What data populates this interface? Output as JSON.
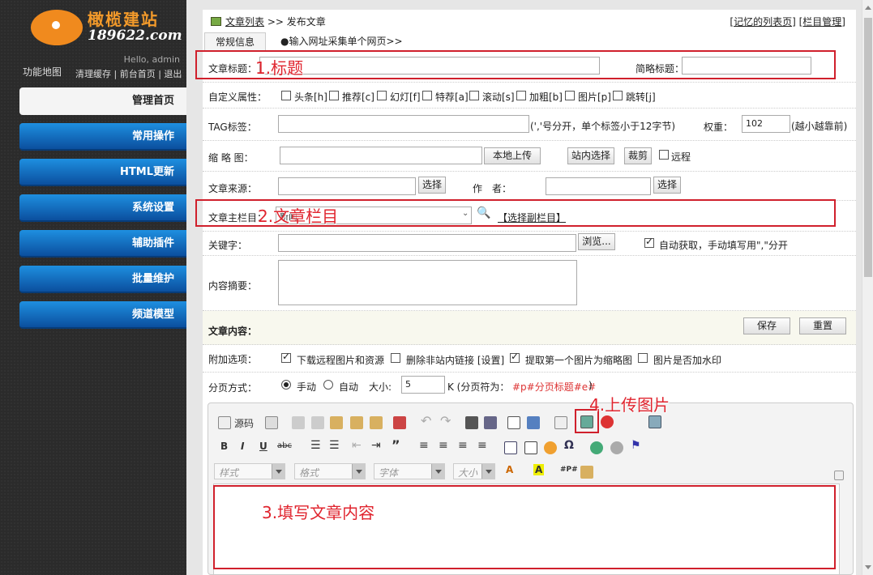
{
  "sidebar": {
    "logo_text": "橄榄建站",
    "logo_url": "189622.com",
    "hello": "Hello, admin",
    "map_link": "功能地图",
    "top_links": [
      "清理缓存",
      "前台首页",
      "退出"
    ],
    "nav_items": [
      "管理首页",
      "常用操作",
      "HTML更新",
      "系统设置",
      "辅助插件",
      "批量维护",
      "频道模型"
    ]
  },
  "header": {
    "crumb_link": "文章列表",
    "crumb_sep": ">>",
    "crumb_current": "发布文章",
    "right_links": [
      "[记忆的列表页]",
      "[栏目管理]"
    ],
    "tabs": [
      "常规信息",
      "●输入网址采集单个网页>>"
    ]
  },
  "form": {
    "title_label": "文章标题：",
    "short_title_label": "简略标题：",
    "attr_label": "自定义属性：",
    "attrs": [
      "头条[h]",
      "推荐[c]",
      "幻灯[f]",
      "特荐[a]",
      "滚动[s]",
      "加粗[b]",
      "图片[p]",
      "跳转[j]"
    ],
    "tag_label": "TAG标签：",
    "tag_hint": "(','号分开，单个标签小于12字节)",
    "weight_label": "权重：",
    "weight_value": "102",
    "weight_hint": "(越小越靠前)",
    "thumb_label": "缩 略 图：",
    "upload_btn": "本地上传",
    "site_select_btn": "站内选择",
    "crop_btn": "裁剪",
    "remote_label": "远程",
    "source_label": "文章来源：",
    "select_btn": "选择",
    "author_label": "作　者：",
    "category_label": "文章主栏目：",
    "category_value": "新闻",
    "sub_category_link": "【选择副栏目】",
    "keywords_label": "关键字：",
    "browse_btn": "浏览...",
    "auto_keywords": "自动获取，手动填写用\",\"分开",
    "summary_label": "内容摘要：",
    "content_label": "文章内容：",
    "save_btn": "保存",
    "reset_btn": "重置",
    "extra_label": "附加选项：",
    "extra_options": [
      "下载远程图片和资源",
      "删除非站内链接 [设置]",
      "提取第一个图片为缩略图",
      "图片是否加水印"
    ],
    "paging_label": "分页方式：",
    "paging_manual": "手动",
    "paging_auto": "自动",
    "size_label": "大小:",
    "size_value": "5",
    "size_unit": "K (分页符为：",
    "page_mark": "#p#分页标题#e#",
    "page_mark_end": ")"
  },
  "editor": {
    "source_label": "源码",
    "style_select": "样式",
    "format_select": "格式",
    "font_select": "字体",
    "size_select": "大小"
  },
  "annotations": [
    "1.标题",
    "2.文章栏目",
    "3.填写文章内容",
    "4.上传图片"
  ],
  "colors": {
    "annotation": "#d0202c",
    "nav_blue": "#1565c0",
    "logo_orange": "#f08a1e"
  }
}
